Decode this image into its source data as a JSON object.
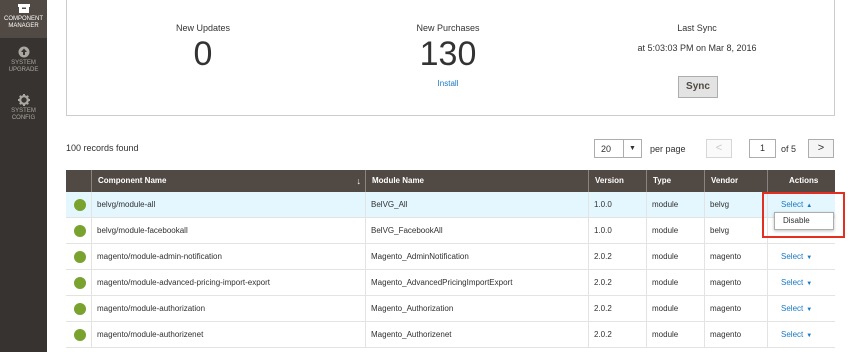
{
  "nav": [
    {
      "label_line1": "COMPONENT",
      "label_line2": "MANAGER",
      "icon": "box-icon",
      "active": true
    },
    {
      "label_line1": "SYSTEM",
      "label_line2": "UPGRADE",
      "icon": "upgrade-icon",
      "active": false
    },
    {
      "label_line1": "SYSTEM",
      "label_line2": "CONFIG",
      "icon": "gear-icon",
      "active": false
    }
  ],
  "stats": {
    "updates_label": "New Updates",
    "updates_value": "0",
    "purchases_label": "New Purchases",
    "purchases_value": "130",
    "install_link": "Install",
    "sync_label": "Last Sync",
    "sync_time": "at 5:03:03 PM on Mar 8, 2016",
    "sync_button": "Sync"
  },
  "toolbar": {
    "records_found": "100 records found",
    "per_page_value": "20",
    "per_page_label": "per page",
    "prev_symbol": "<",
    "next_symbol": ">",
    "page_value": "1",
    "page_of": "of 5"
  },
  "grid": {
    "headers": {
      "component": "Component Name",
      "sort_indicator": "↓",
      "module": "Module Name",
      "version": "Version",
      "type": "Type",
      "vendor": "Vendor",
      "actions": "Actions"
    },
    "rows": [
      {
        "component": "belvg/module-all",
        "module": "BelVG_All",
        "version": "1.0.0",
        "type": "module",
        "vendor": "belvg",
        "action": "Select",
        "caret": "▲"
      },
      {
        "component": "belvg/module-facebookall",
        "module": "BelVG_FacebookAll",
        "version": "1.0.0",
        "type": "module",
        "vendor": "belvg",
        "action": "",
        "caret": ""
      },
      {
        "component": "magento/module-admin-notification",
        "module": "Magento_AdminNotification",
        "version": "2.0.2",
        "type": "module",
        "vendor": "magento",
        "action": "Select",
        "caret": "▼"
      },
      {
        "component": "magento/module-advanced-pricing-import-export",
        "module": "Magento_AdvancedPricingImportExport",
        "version": "2.0.2",
        "type": "module",
        "vendor": "magento",
        "action": "Select",
        "caret": "▼"
      },
      {
        "component": "magento/module-authorization",
        "module": "Magento_Authorization",
        "version": "2.0.2",
        "type": "module",
        "vendor": "magento",
        "action": "Select",
        "caret": "▼"
      },
      {
        "component": "magento/module-authorizenet",
        "module": "Magento_Authorizenet",
        "version": "2.0.2",
        "type": "module",
        "vendor": "magento",
        "action": "Select",
        "caret": "▼"
      }
    ]
  },
  "dropdown": {
    "option": "Disable"
  },
  "colors": {
    "nav_bg": "#373330",
    "grid_header": "#514943",
    "link": "#1979c3",
    "status_dot": "#79a22e",
    "highlight": "#e22f22"
  }
}
